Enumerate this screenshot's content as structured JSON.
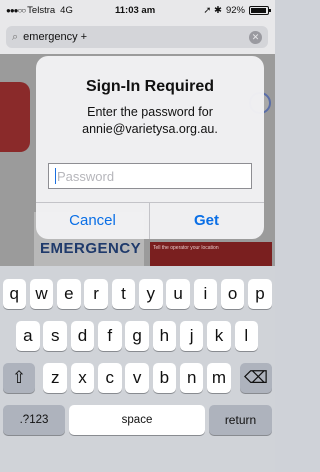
{
  "status_bar": {
    "signal_dots": "●●●○○",
    "carrier": "Telstra",
    "network": "4G",
    "time": "11:03 am",
    "indicators": "➚ ✱",
    "battery_percent": "92%",
    "battery_level": 0.92
  },
  "search": {
    "query": "emergency +",
    "search_icon": "magnifier-icon",
    "clear_icon": "clear-icon"
  },
  "background": {
    "emergency_label": "EMERGENCY",
    "panel_text": "Tell the operator your location"
  },
  "alert": {
    "title": "Sign-In Required",
    "message": "Enter the password for annie@varietysa.org.au.",
    "password_placeholder": "Password",
    "cancel_label": "Cancel",
    "get_label": "Get"
  },
  "keyboard": {
    "row1": [
      "q",
      "w",
      "e",
      "r",
      "t",
      "y",
      "u",
      "i",
      "o",
      "p"
    ],
    "row2": [
      "a",
      "s",
      "d",
      "f",
      "g",
      "h",
      "j",
      "k",
      "l"
    ],
    "row3": [
      "z",
      "x",
      "c",
      "v",
      "b",
      "n",
      "m"
    ],
    "shift_glyph": "⇧",
    "delete_glyph": "⌫",
    "numbers_label": ".?123",
    "space_label": "space",
    "return_label": "return"
  }
}
